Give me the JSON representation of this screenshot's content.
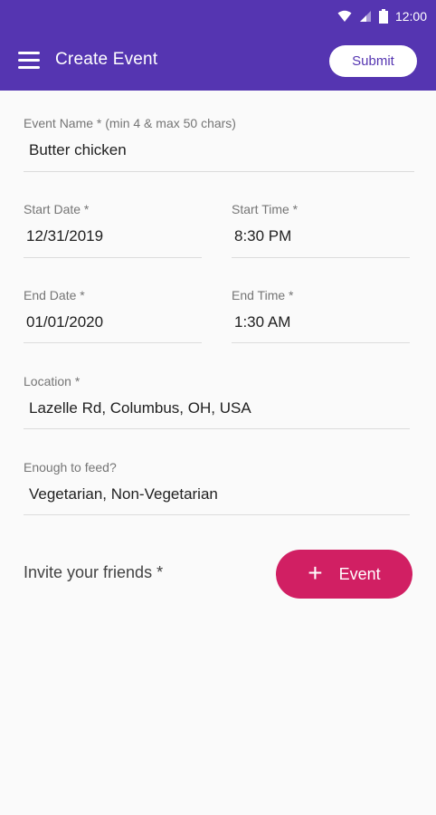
{
  "status_bar": {
    "time": "12:00"
  },
  "toolbar": {
    "title": "Create Event",
    "submit_label": "Submit",
    "menu_icon": "hamburger-menu-icon"
  },
  "form": {
    "event_name": {
      "label": "Event Name * (min 4 & max 50 chars)",
      "value": "Butter chicken"
    },
    "start_date": {
      "label": "Start Date *",
      "value": "12/31/2019"
    },
    "start_time": {
      "label": "Start Time *",
      "value": "8:30 PM"
    },
    "end_date": {
      "label": "End Date *",
      "value": "01/01/2020"
    },
    "end_time": {
      "label": "End Time *",
      "value": "1:30 AM"
    },
    "location": {
      "label": "Location *",
      "value": "Lazelle Rd, Columbus, OH, USA"
    },
    "feed": {
      "label": "Enough to feed?",
      "value": "Vegetarian, Non-Vegetarian"
    }
  },
  "invite": {
    "label": "Invite your friends *",
    "button_label": "Event",
    "button_icon": "plus-icon"
  },
  "colors": {
    "primary": "#5535b1",
    "accent": "#d11f63"
  }
}
